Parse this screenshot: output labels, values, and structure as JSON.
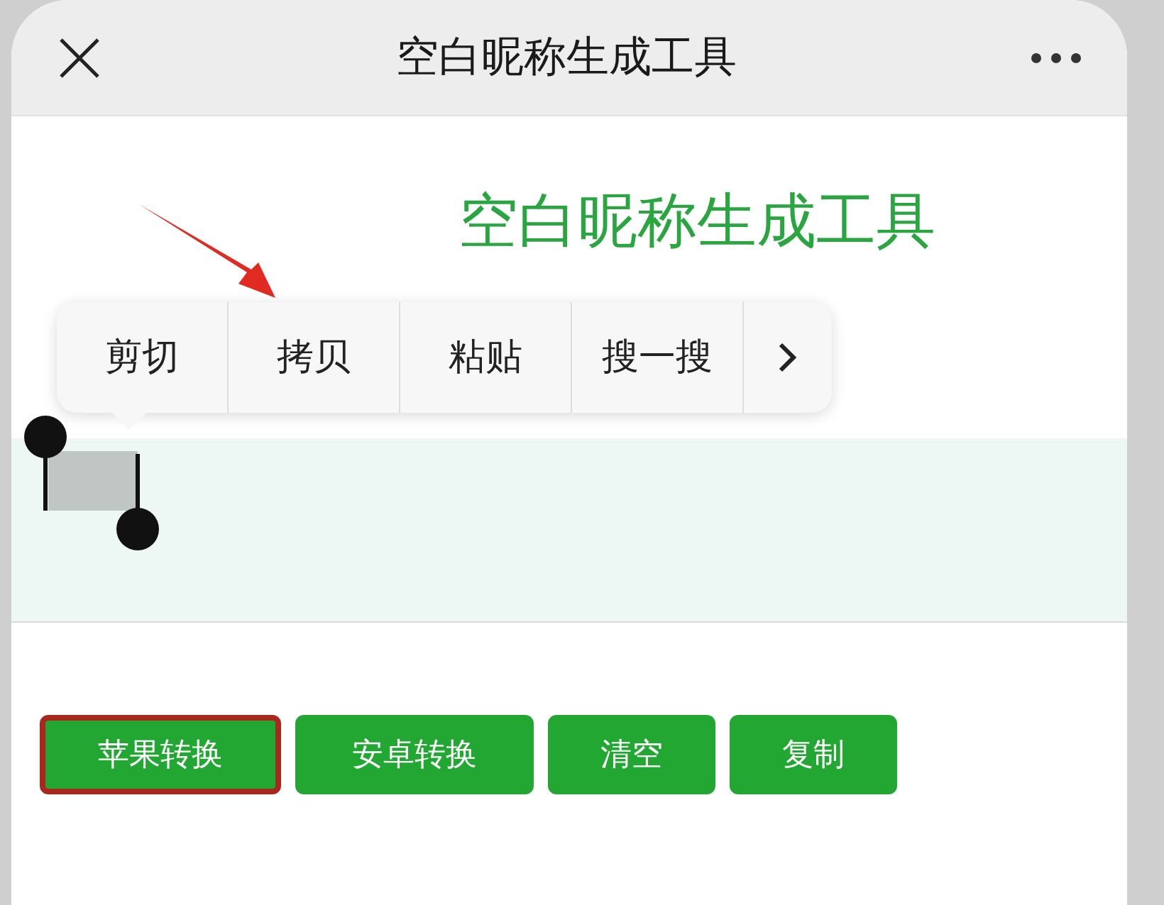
{
  "header": {
    "title": "空白昵称生成工具"
  },
  "page_title": "空白昵称生成工具",
  "context_menu": {
    "items": [
      "剪切",
      "拷贝",
      "粘贴",
      "搜一搜"
    ]
  },
  "buttons": [
    {
      "label": "苹果转换",
      "highlighted": true
    },
    {
      "label": "安卓转换",
      "highlighted": false
    },
    {
      "label": "清空",
      "highlighted": false
    },
    {
      "label": "复制",
      "highlighted": false
    }
  ]
}
